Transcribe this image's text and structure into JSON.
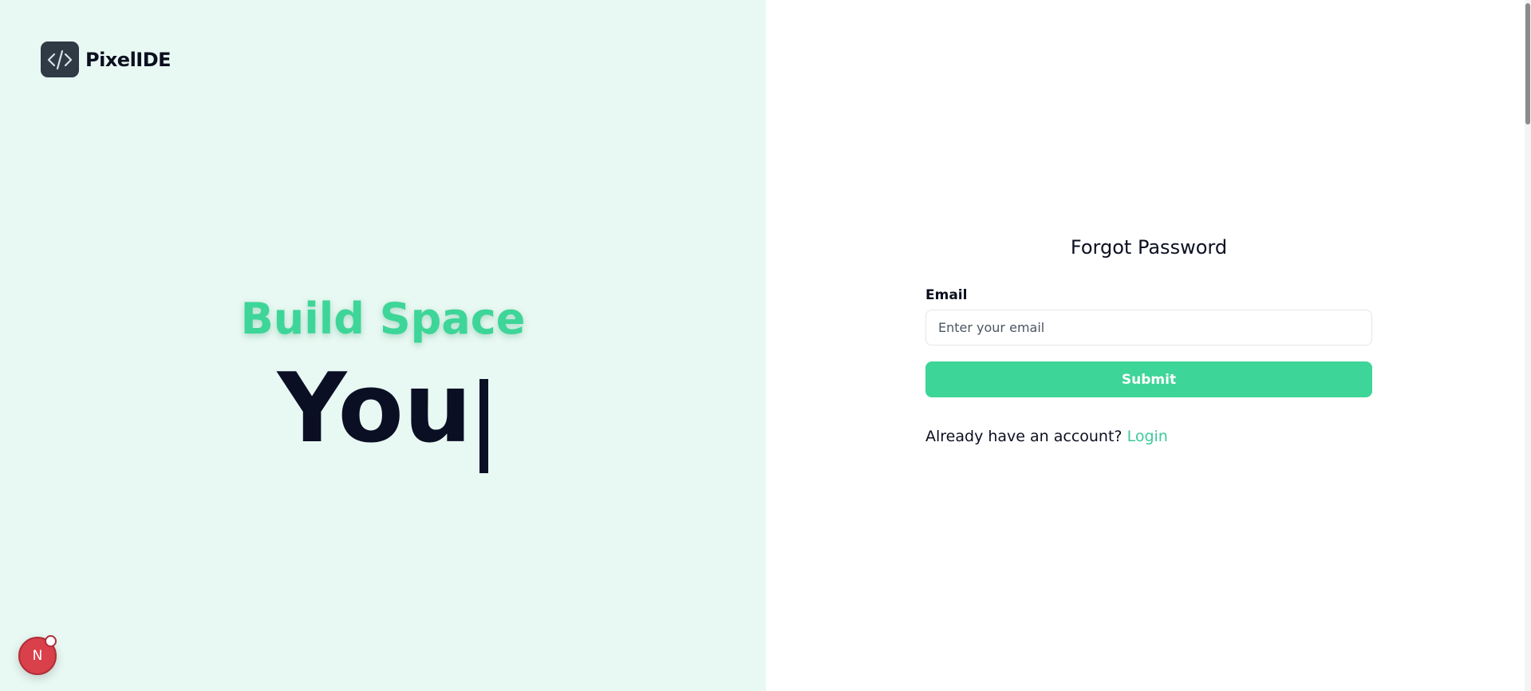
{
  "brand": {
    "name": "PixelIDE",
    "logo_icon": "code-brackets-icon"
  },
  "hero": {
    "tagline": "Build Space",
    "typed_word": "You"
  },
  "form": {
    "title": "Forgot Password",
    "email_label": "Email",
    "email_placeholder": "Enter your email",
    "email_value": "",
    "submit_label": "Submit",
    "login_prompt": "Already have an account?",
    "login_link": "Login"
  },
  "badge": {
    "letter": "N"
  },
  "colors": {
    "accent": "#3ed598",
    "left_background": "#e8f8f2",
    "dark_text": "#0b0f24",
    "badge_red": "#d9404a"
  }
}
